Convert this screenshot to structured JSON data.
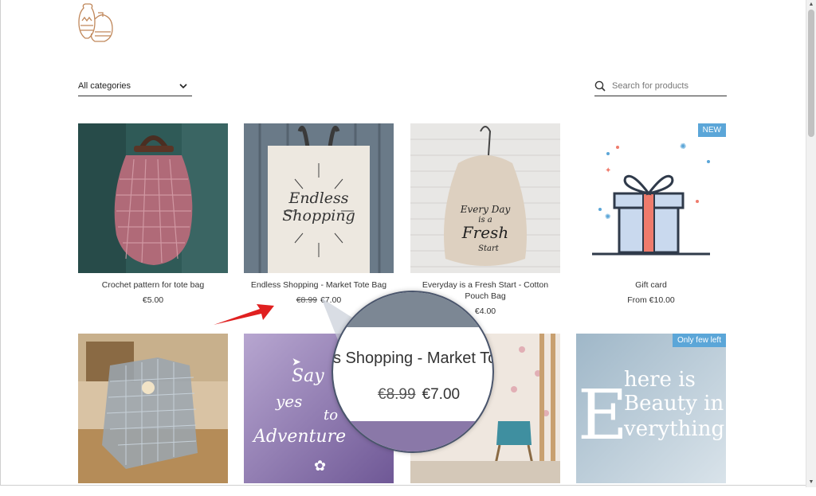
{
  "header": {
    "logo": "pottery-logo",
    "category_select": "All categories",
    "search_placeholder": "Search for products"
  },
  "products": [
    {
      "name": "Crochet pattern for tote bag",
      "price": "€5.00"
    },
    {
      "name": "Endless Shopping - Market Tote Bag",
      "old_price": "€8.99",
      "price": "€7.00",
      "image_text_1": "Endless",
      "image_text_2": "Shopping"
    },
    {
      "name": "Everyday is a Fresh Start - Cotton Pouch Bag",
      "price": "€",
      "price_partial": "4.00",
      "image_text_1": "Every Day",
      "image_text_2": "is a",
      "image_text_3": "Fresh",
      "image_text_4": "Start"
    },
    {
      "name": "Gift card",
      "price": "From €10.00",
      "badge": "NEW"
    }
  ],
  "row2": [
    {
      "name": "",
      "image": "crochet-market-bag"
    },
    {
      "name": "",
      "image": "adventure-poster",
      "image_text_1": "Say",
      "image_text_2": "yes",
      "image_text_3": "to",
      "image_text_4": "Adventure"
    },
    {
      "name": "",
      "image": "room-interior"
    },
    {
      "name": "",
      "image": "beauty-poster",
      "badge": "Only few left",
      "image_text_1": "here is",
      "image_text_2": "Beauty in",
      "image_text_3": "verything"
    }
  ],
  "magnifier": {
    "name_zoom": "s Shopping - Market To",
    "old_price": "€8.99",
    "price": "€7.00"
  },
  "colors": {
    "badge_blue": "#5ba6d8",
    "arrow_red": "#e02020",
    "magnifier_border": "#4a556c",
    "logo_brown": "#c0875a"
  }
}
